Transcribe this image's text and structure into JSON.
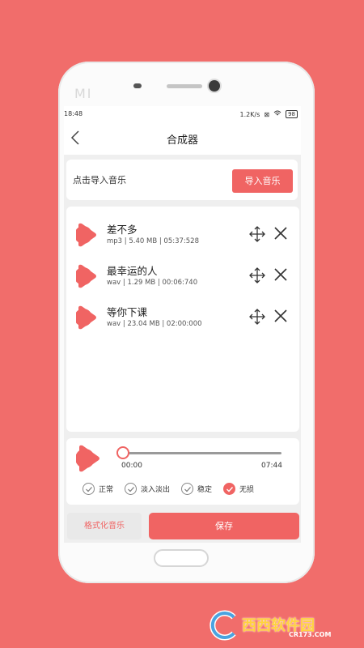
{
  "status_bar": {
    "time": "18:48",
    "net_speed": "1.2K/s",
    "battery": "98"
  },
  "header": {
    "title": "合成器"
  },
  "import": {
    "prompt": "点击导入音乐",
    "button_label": "导入音乐"
  },
  "songs": [
    {
      "name": "差不多",
      "meta": "mp3 | 5.40 MB | 05:37:528"
    },
    {
      "name": "最幸运的人",
      "meta": "wav | 1.29 MB | 00:06:740"
    },
    {
      "name": "等你下课",
      "meta": "wav | 23.04 MB | 02:00:000"
    }
  ],
  "player": {
    "current_time": "00:00",
    "total_time": "07:44",
    "progress": 0
  },
  "options": [
    {
      "label": "正常",
      "checked": false
    },
    {
      "label": "淡入淡出",
      "checked": false
    },
    {
      "label": "稳定",
      "checked": false
    },
    {
      "label": "无损",
      "checked": true
    }
  ],
  "footer": {
    "format_label": "格式化音乐",
    "save_label": "保存"
  },
  "watermark": {
    "brand": "西西软件园",
    "url": "CR173.COM"
  },
  "device": {
    "logo": "MI"
  },
  "colors": {
    "accent": "#f06463",
    "background": "#f16d6b"
  }
}
